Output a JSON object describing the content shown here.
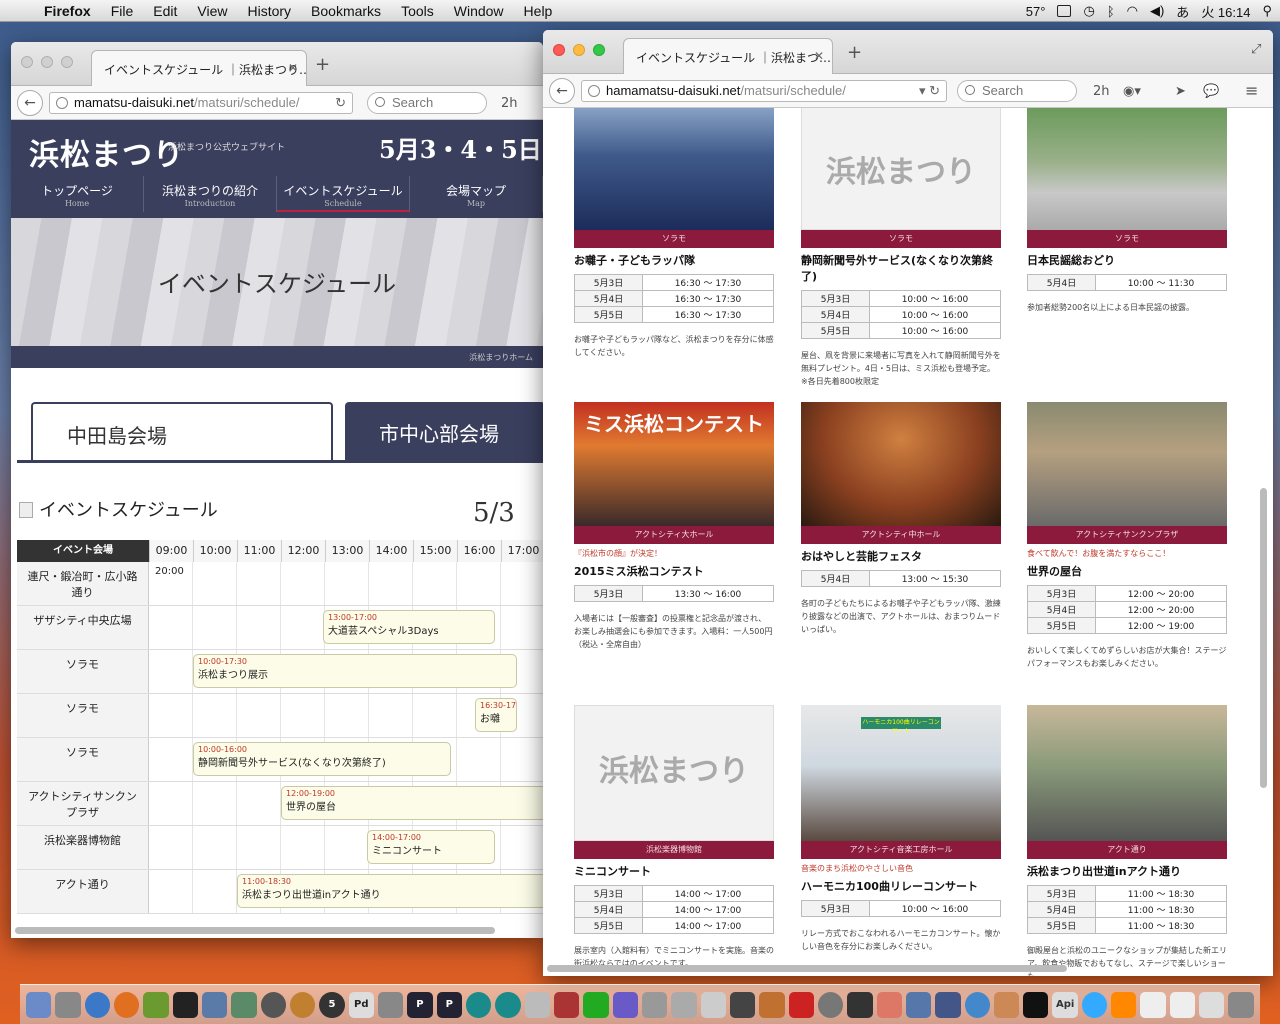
{
  "menubar": {
    "app_name": "Firefox",
    "menus": [
      "File",
      "Edit",
      "View",
      "History",
      "Bookmarks",
      "Tools",
      "Window",
      "Help"
    ],
    "temperature": "57°",
    "input_method": "あ",
    "clock": "火 16:14"
  },
  "back_window": {
    "tab_title": "イベントスケジュール ｜浜松まつり…",
    "url_host": "mamatsu-daisuki.net",
    "url_path": "/matsuri/schedule/",
    "search_placeholder": "Search",
    "site": {
      "logo": "浜松まつり",
      "subtitle": "浜松まつり公式ウェブサイト",
      "dates": "5月3・4・5日"
    },
    "nav": [
      {
        "label": "トップページ",
        "en": "Home"
      },
      {
        "label": "浜松まつりの紹介",
        "en": "Introduction"
      },
      {
        "label": "イベントスケジュール",
        "en": "Schedule"
      },
      {
        "label": "会場マップ",
        "en": "Map"
      }
    ],
    "hero_title": "イベントスケジュール",
    "breadcrumb": "浜松まつりホーム",
    "venue_tabs": [
      "中田島会場",
      "市中心部会場"
    ],
    "schedule_title": "イベントスケジュール",
    "schedule_date": "5/3",
    "venue_header": "イベント会場",
    "hours": [
      "09:00",
      "10:00",
      "11:00",
      "12:00",
      "13:00",
      "14:00",
      "15:00",
      "16:00",
      "17:00"
    ],
    "rows": [
      {
        "venue": "連尺・鍛冶町・広小路通り",
        "plain": "20:00"
      },
      {
        "venue": "ザザシティ中央広場",
        "time": "13:00-17:00",
        "event": "大道芸スペシャル3Days"
      },
      {
        "venue": "ソラモ",
        "time": "10:00-17:30",
        "event": "浜松まつり展示"
      },
      {
        "venue": "ソラモ",
        "time": "16:30-17:",
        "event": "お囃"
      },
      {
        "venue": "ソラモ",
        "time": "10:00-16:00",
        "event": "静岡新聞号外サービス(なくなり次第終了)"
      },
      {
        "venue": "アクトシティサンクンプラザ",
        "time": "12:00-19:00",
        "event": "世界の屋台"
      },
      {
        "venue": "浜松楽器博物館",
        "time": "14:00-17:00",
        "event": "ミニコンサート"
      },
      {
        "venue": "アクト通り",
        "time": "11:00-18:30",
        "event": "浜松まつり出世道inアクト通り"
      }
    ]
  },
  "front_window": {
    "tab_title": "イベントスケジュール ｜浜松まつ…",
    "url_host": "hamamatsu-daisuki.net",
    "url_path": "/matsuri/schedule/",
    "search_placeholder": "Search",
    "cards": [
      {
        "venue": "ソラモ",
        "title": "お囃子・子どもラッパ隊",
        "times": [
          [
            "5月3日",
            "16:30 〜 17:30"
          ],
          [
            "5月4日",
            "16:30 〜 17:30"
          ],
          [
            "5月5日",
            "16:30 〜 17:30"
          ]
        ],
        "desc": "お囃子や子どもラッパ隊など、浜松まつりを存分に体感してください。"
      },
      {
        "venue": "ソラモ",
        "title": "静岡新聞号外サービス(なくなり次第終了)",
        "times": [
          [
            "5月3日",
            "10:00 〜 16:00"
          ],
          [
            "5月4日",
            "10:00 〜 16:00"
          ],
          [
            "5月5日",
            "10:00 〜 16:00"
          ]
        ],
        "desc": "屋台、凧を背景に来場者に写真を入れて静岡新聞号外を無料プレゼント。4日・5日は、ミス浜松も登場予定。※各日先着800枚限定"
      },
      {
        "venue": "ソラモ",
        "title": "日本民謡総おどり",
        "times": [
          [
            "5月4日",
            "10:00 〜 11:30"
          ]
        ],
        "desc": "参加者総勢200名以上による日本民謡の披露。"
      },
      {
        "venue": "アクトシティ大ホール",
        "note": "『浜松市の顔』が決定！",
        "title": "2015ミス浜松コンテスト",
        "times": [
          [
            "5月3日",
            "13:30 〜 16:00"
          ]
        ],
        "desc": "入場者には【一般審査】の投票権と記念品が渡され、お楽しみ抽選会にも参加できます。入場料：一人500円（税込・全席自由）",
        "img_text": "ミス浜松コンテスト"
      },
      {
        "venue": "アクトシティ中ホール",
        "title": "おはやしと芸能フェスタ",
        "times": [
          [
            "5月4日",
            "13:00 〜 15:30"
          ]
        ],
        "desc": "各町の子どもたちによるお囃子や子どもラッパ隊、激練り披露などの出演で、アクトホールは、おまつりムードいっぱい。"
      },
      {
        "venue": "アクトシティサンクンプラザ",
        "note": "食べて飲んで！お腹を満たすならここ！",
        "title": "世界の屋台",
        "times": [
          [
            "5月3日",
            "12:00 〜 20:00"
          ],
          [
            "5月4日",
            "12:00 〜 20:00"
          ],
          [
            "5月5日",
            "12:00 〜 19:00"
          ]
        ],
        "desc": "おいしくて楽しくてめずらしいお店が大集合！ステージパフォーマンスもお楽しみください。"
      },
      {
        "venue": "浜松楽器博物館",
        "title": "ミニコンサート",
        "times": [
          [
            "5月3日",
            "14:00 〜 17:00"
          ],
          [
            "5月4日",
            "14:00 〜 17:00"
          ],
          [
            "5月5日",
            "14:00 〜 17:00"
          ]
        ],
        "desc": "展示室内（入館料有）でミニコンサートを実施。音楽の街浜松ならではのイベントです。"
      },
      {
        "venue": "アクトシティ音楽工房ホール",
        "note": "音楽のまち浜松のやさしい音色",
        "title": "ハーモニカ100曲リレーコンサート",
        "times": [
          [
            "5月3日",
            "10:00 〜 16:00"
          ]
        ],
        "desc": "リレー方式でおこなわれるハーモニカコンサート。懐かしい音色を存分にお楽しみください。",
        "img_text": "ハーモニカ100曲リレーコンサート"
      },
      {
        "venue": "アクト通り",
        "title": "浜松まつり出世道inアクト通り",
        "times": [
          [
            "5月3日",
            "11:00 〜 18:30"
          ],
          [
            "5月4日",
            "11:00 〜 18:30"
          ],
          [
            "5月5日",
            "11:00 〜 18:30"
          ]
        ],
        "desc": "御殿屋台と浜松のユニークなショップが集結した新エリア。飲食や物販でおもてなし、ステージで楽しいショーも"
      }
    ],
    "logo_placeholder": "浜松まつり"
  },
  "dock": {
    "badge": "5"
  }
}
